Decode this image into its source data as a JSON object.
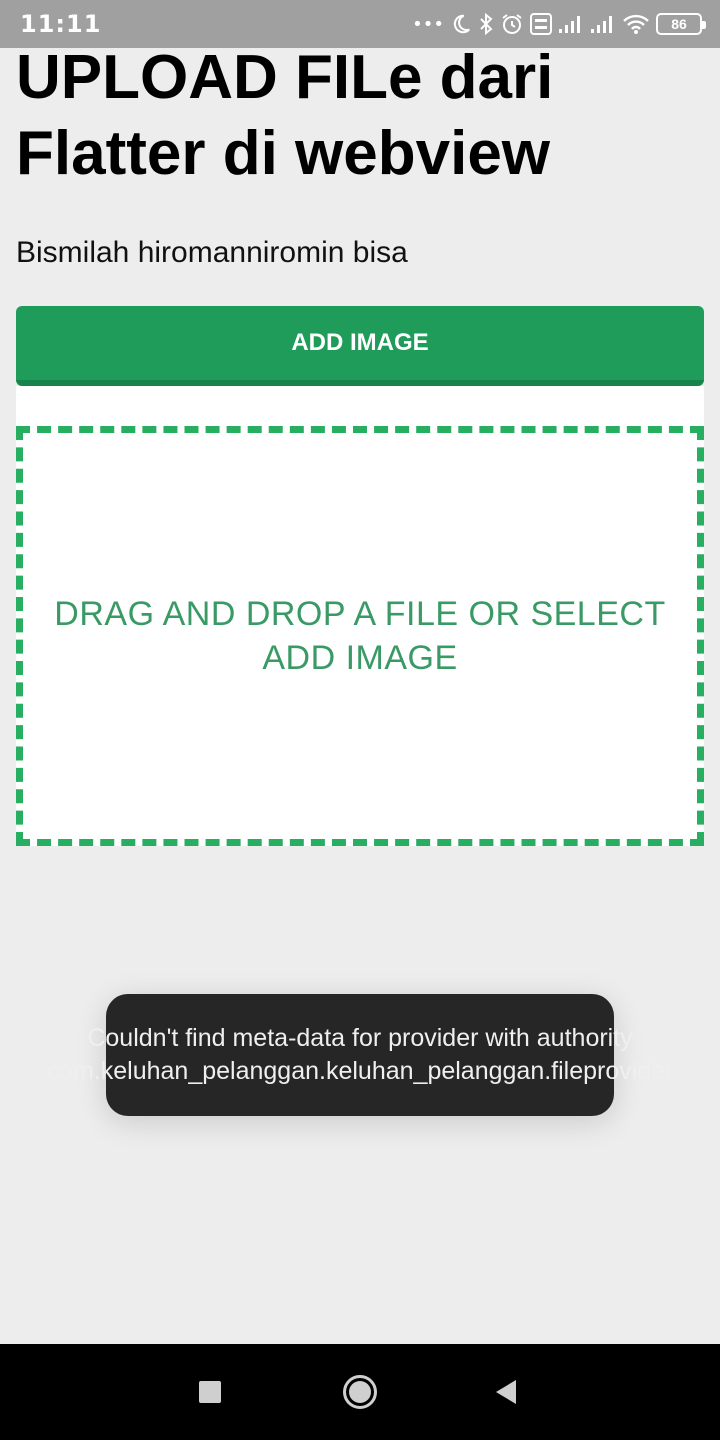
{
  "status_bar": {
    "time": "11:11",
    "dots": "•••",
    "battery": "86",
    "icons": [
      "moon-icon",
      "bluetooth-icon",
      "alarm-icon",
      "volte-icon",
      "signal-icon",
      "signal-icon",
      "wifi-icon",
      "battery-icon"
    ]
  },
  "page": {
    "title": "UPLOAD FILe dari Flatter di webview",
    "subtitle": "Bismilah hiromanniromin bisa"
  },
  "add_image_button": {
    "label": "ADD IMAGE"
  },
  "drop_zone": {
    "text": "DRAG AND DROP A FILE OR SELECT ADD IMAGE"
  },
  "toast": {
    "message": "Couldn't find meta-data for provider with authority com.keluhan_pelanggan.keluhan_pelanggan.fileprovider"
  },
  "colors": {
    "accent": "#1f9c5a",
    "dashed_border": "#27ae60",
    "drop_text": "#3a9a66",
    "toast_bg": "#262626",
    "status_bar_bg": "#a0a0a0"
  }
}
